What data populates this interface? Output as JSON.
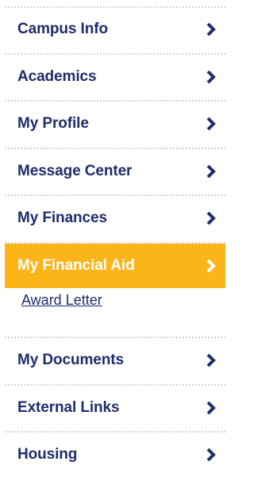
{
  "nav": {
    "items": [
      {
        "label": "Campus Info"
      },
      {
        "label": "Academics"
      },
      {
        "label": "My Profile"
      },
      {
        "label": "Message Center"
      },
      {
        "label": "My Finances"
      },
      {
        "label": "My Financial Aid"
      },
      {
        "label": "My Documents"
      },
      {
        "label": "External Links"
      },
      {
        "label": "Housing"
      }
    ],
    "active_index": 5,
    "sub_items": [
      {
        "label": "Award Letter"
      }
    ]
  },
  "icons": {
    "chevron": "chevron-right-icon"
  },
  "colors": {
    "text": "#1f2d6a",
    "active_bg": "#fbb519",
    "active_text": "#ffffff",
    "divider": "#d4d4d4"
  }
}
